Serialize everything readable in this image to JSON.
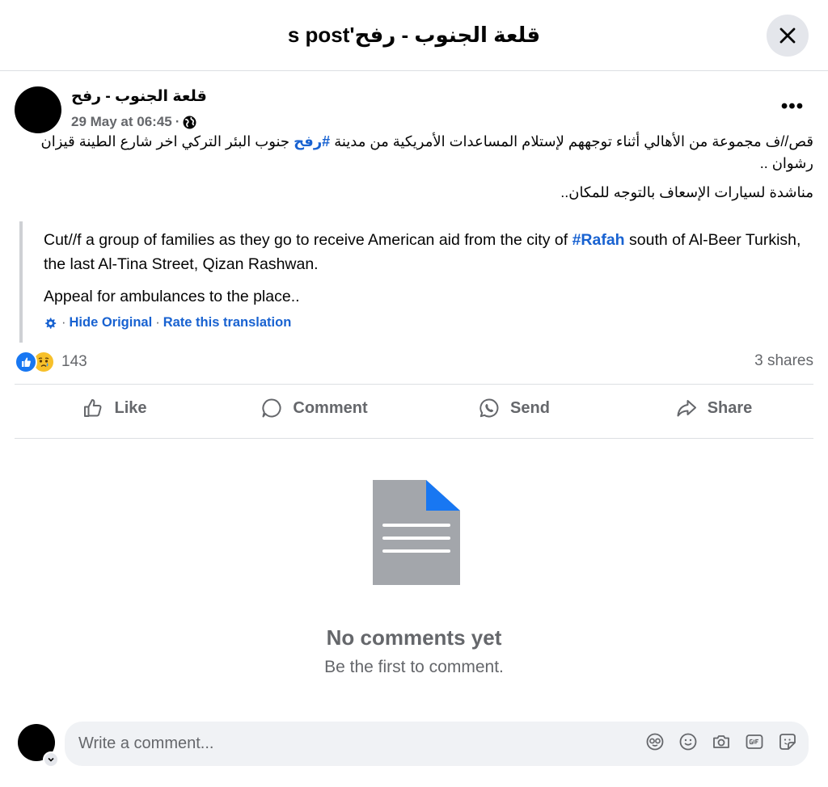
{
  "header": {
    "title": "قلعة الجنوب - رفح's post"
  },
  "post": {
    "author": "قلعة الجنوب - رفح",
    "timestamp": "29 May at 06:45",
    "meta_separator": "·",
    "audience_icon": "globe-icon",
    "more_label": "•••",
    "arabic_line1_before": "قص//ف مجموعة من الأهالي أثناء توجههم لإستلام المساعدات الأمريكية من مدينة ",
    "arabic_hashtag": "#رفح",
    "arabic_line1_after": " جنوب البئر التركي اخر شارع الطينة قيزان رشوان ..",
    "arabic_line2": "مناشدة لسيارات الإسعاف بالتوجه للمكان.."
  },
  "translation": {
    "text1_before": "Cut//f a group of families as they go to receive American aid from the city of ",
    "text1_hashtag": "#Rafah",
    "text1_after": " south of Al-Beer Turkish, the last Al-Tina Street, Qizan Rashwan.",
    "text2": "Appeal for ambulances to the place..",
    "hide_original": "Hide Original",
    "rate": "Rate this translation",
    "separator": "·"
  },
  "stats": {
    "reaction_count": "143",
    "shares": "3 shares",
    "reaction_icons": [
      "like-icon",
      "sad-icon"
    ]
  },
  "actions": {
    "like": "Like",
    "comment": "Comment",
    "send": "Send",
    "share": "Share"
  },
  "comments": {
    "empty_title": "No comments yet",
    "empty_subtitle": "Be the first to comment."
  },
  "composer": {
    "placeholder": "Write a comment...",
    "tools": [
      "avatar-sticker-icon",
      "emoji-icon",
      "camera-icon",
      "gif-icon",
      "sticker-icon"
    ]
  },
  "colors": {
    "accent": "#1862d1",
    "like_blue": "#1877f2",
    "muted_text": "#65676b",
    "doc_grey": "#a3a6ab",
    "doc_corner": "#1877f2"
  }
}
